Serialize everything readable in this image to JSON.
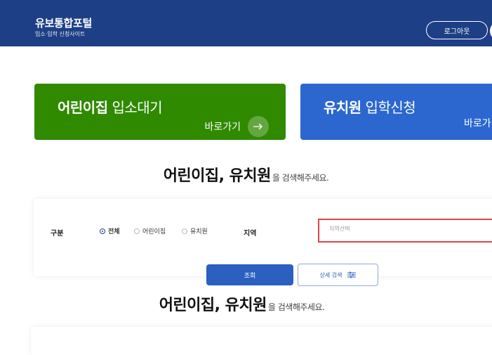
{
  "header": {
    "title": "유보통합포털",
    "subtitle": "입소·입학 신청사이트",
    "logout_label": "로그아웃"
  },
  "cards": {
    "daycare": {
      "title_bold": "어린이집",
      "title_rest": " 입소대기",
      "link_label": "바로가기"
    },
    "kindergarten": {
      "title_bold": "유치원",
      "title_rest": " 입학신청",
      "link_label": "바로가기"
    }
  },
  "heading": {
    "main": "어린이집, 유치원",
    "suffix": "을 검색해주세요."
  },
  "search": {
    "type_label": "구분",
    "options": [
      "전체",
      "어린이집",
      "유치원"
    ],
    "selected_option": "전체",
    "region_label": "지역",
    "region_placeholder": "지역선택",
    "search_button": "조회",
    "detail_button": "상세 검색"
  },
  "heading_repeat": {
    "main": "어린이집, 유치원",
    "suffix": "을 검색해주세요."
  },
  "colors": {
    "header": "#1d3f86",
    "daycare_card": "#2f8a00",
    "kinder_card": "#2b67cf",
    "primary_button": "#2b5fc0",
    "input_border_alert": "#e0424b"
  }
}
